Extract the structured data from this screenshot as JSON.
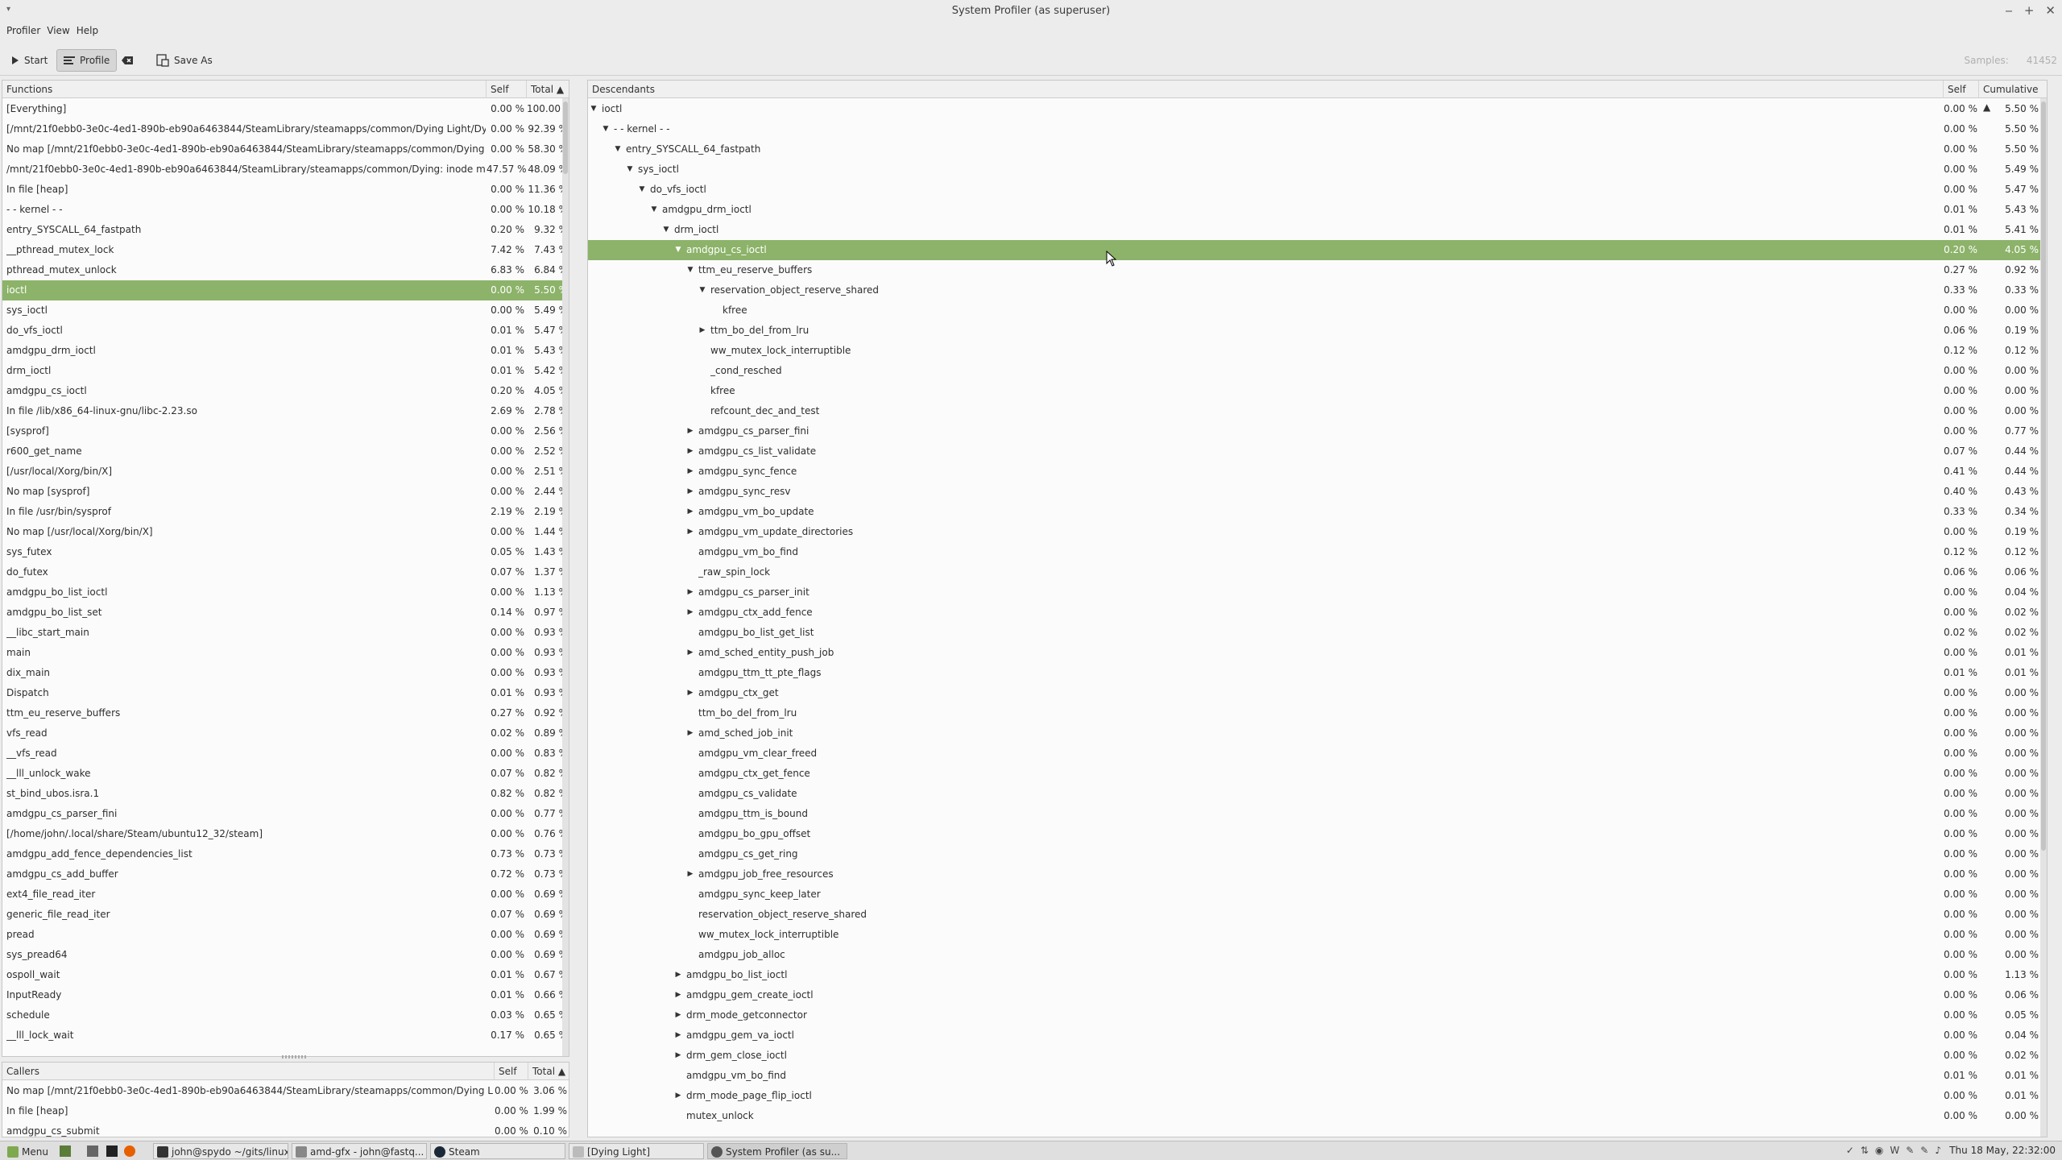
{
  "window": {
    "title": "System Profiler (as superuser)",
    "wm_menu": "▾",
    "wm_buttons": [
      "‒",
      "+",
      "✕"
    ]
  },
  "menubar": [
    "Profiler",
    "View",
    "Help"
  ],
  "toolbar": {
    "start_label": "Start",
    "profile_label": "Profile",
    "save_as_label": "Save As",
    "samples_label": "Samples:",
    "samples_value": "41452"
  },
  "functions": {
    "headers": {
      "name": "Functions",
      "self": "Self",
      "total": "Total ▲"
    },
    "selected_index": 10,
    "rows": [
      [
        "[Everything]",
        "0.00 %",
        "100.00 %"
      ],
      [
        "[/mnt/21f0ebb0-3e0c-4ed1-890b-eb90a6463844/SteamLibrary/steamapps/common/Dying Light/DyingLi...",
        "0.00 %",
        "92.39 %"
      ],
      [
        "No map [/mnt/21f0ebb0-3e0c-4ed1-890b-eb90a6463844/SteamLibrary/steamapps/common/Dying Light...",
        "0.00 %",
        "58.30 %"
      ],
      [
        "/mnt/21f0ebb0-3e0c-4ed1-890b-eb90a6463844/SteamLibrary/steamapps/common/Dying: inode misma...",
        "47.57 %",
        "48.09 %"
      ],
      [
        "In file [heap]",
        "0.00 %",
        "11.36 %"
      ],
      [
        "- - kernel - -",
        "0.00 %",
        "10.18 %"
      ],
      [
        "entry_SYSCALL_64_fastpath",
        "0.20 %",
        "9.32 %"
      ],
      [
        "__pthread_mutex_lock",
        "7.42 %",
        "7.43 %"
      ],
      [
        "pthread_mutex_unlock",
        "6.83 %",
        "6.84 %"
      ],
      [
        "",
        "",
        ""
      ],
      [
        "ioctl",
        "0.00 %",
        "5.50 %"
      ],
      [
        "sys_ioctl",
        "0.00 %",
        "5.49 %"
      ],
      [
        "do_vfs_ioctl",
        "0.01 %",
        "5.47 %"
      ],
      [
        "amdgpu_drm_ioctl",
        "0.01 %",
        "5.43 %"
      ],
      [
        "drm_ioctl",
        "0.01 %",
        "5.42 %"
      ],
      [
        "amdgpu_cs_ioctl",
        "0.20 %",
        "4.05 %"
      ],
      [
        "In file /lib/x86_64-linux-gnu/libc-2.23.so",
        "2.69 %",
        "2.78 %"
      ],
      [
        "[sysprof]",
        "0.00 %",
        "2.56 %"
      ],
      [
        "r600_get_name",
        "0.00 %",
        "2.52 %"
      ],
      [
        "[/usr/local/Xorg/bin/X]",
        "0.00 %",
        "2.51 %"
      ],
      [
        "No map [sysprof]",
        "0.00 %",
        "2.44 %"
      ],
      [
        "In file /usr/bin/sysprof",
        "2.19 %",
        "2.19 %"
      ],
      [
        "No map [/usr/local/Xorg/bin/X]",
        "0.00 %",
        "1.44 %"
      ],
      [
        "sys_futex",
        "0.05 %",
        "1.43 %"
      ],
      [
        "do_futex",
        "0.07 %",
        "1.37 %"
      ],
      [
        "amdgpu_bo_list_ioctl",
        "0.00 %",
        "1.13 %"
      ],
      [
        "amdgpu_bo_list_set",
        "0.14 %",
        "0.97 %"
      ],
      [
        "__libc_start_main",
        "0.00 %",
        "0.93 %"
      ],
      [
        "main",
        "0.00 %",
        "0.93 %"
      ],
      [
        "dix_main",
        "0.00 %",
        "0.93 %"
      ],
      [
        "Dispatch",
        "0.01 %",
        "0.93 %"
      ],
      [
        "ttm_eu_reserve_buffers",
        "0.27 %",
        "0.92 %"
      ],
      [
        "vfs_read",
        "0.02 %",
        "0.89 %"
      ],
      [
        "__vfs_read",
        "0.00 %",
        "0.83 %"
      ],
      [
        "__lll_unlock_wake",
        "0.07 %",
        "0.82 %"
      ],
      [
        "st_bind_ubos.isra.1",
        "0.82 %",
        "0.82 %"
      ],
      [
        "amdgpu_cs_parser_fini",
        "0.00 %",
        "0.77 %"
      ],
      [
        "[/home/john/.local/share/Steam/ubuntu12_32/steam]",
        "0.00 %",
        "0.76 %"
      ],
      [
        "amdgpu_add_fence_dependencies_list",
        "0.73 %",
        "0.73 %"
      ],
      [
        "amdgpu_cs_add_buffer",
        "0.72 %",
        "0.73 %"
      ],
      [
        "ext4_file_read_iter",
        "0.00 %",
        "0.69 %"
      ],
      [
        "generic_file_read_iter",
        "0.07 %",
        "0.69 %"
      ],
      [
        "pread",
        "0.00 %",
        "0.69 %"
      ],
      [
        "sys_pread64",
        "0.00 %",
        "0.69 %"
      ],
      [
        "ospoll_wait",
        "0.01 %",
        "0.67 %"
      ],
      [
        "InputReady",
        "0.01 %",
        "0.66 %"
      ],
      [
        "schedule",
        "0.03 %",
        "0.65 %"
      ],
      [
        "__lll_lock_wait",
        "0.17 %",
        "0.65 %"
      ]
    ]
  },
  "callers": {
    "headers": {
      "name": "Callers",
      "self": "Self",
      "total": "Total ▲"
    },
    "rows": [
      [
        "No map [/mnt/21f0ebb0-3e0c-4ed1-890b-eb90a6463844/SteamLibrary/steamapps/common/Dying Light/...",
        "0.00 %",
        "3.06 %"
      ],
      [
        "In file [heap]",
        "0.00 %",
        "1.99 %"
      ],
      [
        "amdgpu_cs_submit",
        "0.00 %",
        "0.10 %"
      ]
    ]
  },
  "descendants": {
    "headers": {
      "name": "Descendants",
      "self": "Self",
      "cumulative": "Cumulative ▲"
    },
    "selected_index": 7,
    "rows": [
      {
        "name": "ioctl",
        "depth": 0,
        "exp": "open",
        "self": "0.00 %",
        "cum": "5.50 %"
      },
      {
        "name": "- - kernel - -",
        "depth": 1,
        "exp": "open",
        "self": "0.00 %",
        "cum": "5.50 %"
      },
      {
        "name": "entry_SYSCALL_64_fastpath",
        "depth": 2,
        "exp": "open",
        "self": "0.00 %",
        "cum": "5.50 %"
      },
      {
        "name": "sys_ioctl",
        "depth": 3,
        "exp": "open",
        "self": "0.00 %",
        "cum": "5.49 %"
      },
      {
        "name": "do_vfs_ioctl",
        "depth": 4,
        "exp": "open",
        "self": "0.00 %",
        "cum": "5.47 %"
      },
      {
        "name": "amdgpu_drm_ioctl",
        "depth": 5,
        "exp": "open",
        "self": "0.01 %",
        "cum": "5.43 %"
      },
      {
        "name": "drm_ioctl",
        "depth": 6,
        "exp": "open",
        "self": "0.01 %",
        "cum": "5.41 %"
      },
      {
        "name": "amdgpu_cs_ioctl",
        "depth": 7,
        "exp": "open",
        "self": "0.20 %",
        "cum": "4.05 %"
      },
      {
        "name": "ttm_eu_reserve_buffers",
        "depth": 8,
        "exp": "open",
        "self": "0.27 %",
        "cum": "0.92 %"
      },
      {
        "name": "reservation_object_reserve_shared",
        "depth": 9,
        "exp": "open",
        "self": "0.33 %",
        "cum": "0.33 %"
      },
      {
        "name": "kfree",
        "depth": 10,
        "exp": "",
        "self": "0.00 %",
        "cum": "0.00 %"
      },
      {
        "name": "ttm_bo_del_from_lru",
        "depth": 9,
        "exp": "closed",
        "self": "0.06 %",
        "cum": "0.19 %"
      },
      {
        "name": "ww_mutex_lock_interruptible",
        "depth": 9,
        "exp": "",
        "self": "0.12 %",
        "cum": "0.12 %"
      },
      {
        "name": "_cond_resched",
        "depth": 9,
        "exp": "",
        "self": "0.00 %",
        "cum": "0.00 %"
      },
      {
        "name": "kfree",
        "depth": 9,
        "exp": "",
        "self": "0.00 %",
        "cum": "0.00 %"
      },
      {
        "name": "refcount_dec_and_test",
        "depth": 9,
        "exp": "",
        "self": "0.00 %",
        "cum": "0.00 %"
      },
      {
        "name": "amdgpu_cs_parser_fini",
        "depth": 8,
        "exp": "closed",
        "self": "0.00 %",
        "cum": "0.77 %"
      },
      {
        "name": "amdgpu_cs_list_validate",
        "depth": 8,
        "exp": "closed",
        "self": "0.07 %",
        "cum": "0.44 %"
      },
      {
        "name": "amdgpu_sync_fence",
        "depth": 8,
        "exp": "closed",
        "self": "0.41 %",
        "cum": "0.44 %"
      },
      {
        "name": "amdgpu_sync_resv",
        "depth": 8,
        "exp": "closed",
        "self": "0.40 %",
        "cum": "0.43 %"
      },
      {
        "name": "amdgpu_vm_bo_update",
        "depth": 8,
        "exp": "closed",
        "self": "0.33 %",
        "cum": "0.34 %"
      },
      {
        "name": "amdgpu_vm_update_directories",
        "depth": 8,
        "exp": "closed",
        "self": "0.00 %",
        "cum": "0.19 %"
      },
      {
        "name": "amdgpu_vm_bo_find",
        "depth": 8,
        "exp": "",
        "self": "0.12 %",
        "cum": "0.12 %"
      },
      {
        "name": "_raw_spin_lock",
        "depth": 8,
        "exp": "",
        "self": "0.06 %",
        "cum": "0.06 %"
      },
      {
        "name": "amdgpu_cs_parser_init",
        "depth": 8,
        "exp": "closed",
        "self": "0.00 %",
        "cum": "0.04 %"
      },
      {
        "name": "amdgpu_ctx_add_fence",
        "depth": 8,
        "exp": "closed",
        "self": "0.00 %",
        "cum": "0.02 %"
      },
      {
        "name": "amdgpu_bo_list_get_list",
        "depth": 8,
        "exp": "",
        "self": "0.02 %",
        "cum": "0.02 %"
      },
      {
        "name": "amd_sched_entity_push_job",
        "depth": 8,
        "exp": "closed",
        "self": "0.00 %",
        "cum": "0.01 %"
      },
      {
        "name": "amdgpu_ttm_tt_pte_flags",
        "depth": 8,
        "exp": "",
        "self": "0.01 %",
        "cum": "0.01 %"
      },
      {
        "name": "amdgpu_ctx_get",
        "depth": 8,
        "exp": "closed",
        "self": "0.00 %",
        "cum": "0.00 %"
      },
      {
        "name": "ttm_bo_del_from_lru",
        "depth": 8,
        "exp": "",
        "self": "0.00 %",
        "cum": "0.00 %"
      },
      {
        "name": "amd_sched_job_init",
        "depth": 8,
        "exp": "closed",
        "self": "0.00 %",
        "cum": "0.00 %"
      },
      {
        "name": "amdgpu_vm_clear_freed",
        "depth": 8,
        "exp": "",
        "self": "0.00 %",
        "cum": "0.00 %"
      },
      {
        "name": "amdgpu_ctx_get_fence",
        "depth": 8,
        "exp": "",
        "self": "0.00 %",
        "cum": "0.00 %"
      },
      {
        "name": "amdgpu_cs_validate",
        "depth": 8,
        "exp": "",
        "self": "0.00 %",
        "cum": "0.00 %"
      },
      {
        "name": "amdgpu_ttm_is_bound",
        "depth": 8,
        "exp": "",
        "self": "0.00 %",
        "cum": "0.00 %"
      },
      {
        "name": "amdgpu_bo_gpu_offset",
        "depth": 8,
        "exp": "",
        "self": "0.00 %",
        "cum": "0.00 %"
      },
      {
        "name": "amdgpu_cs_get_ring",
        "depth": 8,
        "exp": "",
        "self": "0.00 %",
        "cum": "0.00 %"
      },
      {
        "name": "amdgpu_job_free_resources",
        "depth": 8,
        "exp": "closed",
        "self": "0.00 %",
        "cum": "0.00 %"
      },
      {
        "name": "amdgpu_sync_keep_later",
        "depth": 8,
        "exp": "",
        "self": "0.00 %",
        "cum": "0.00 %"
      },
      {
        "name": "reservation_object_reserve_shared",
        "depth": 8,
        "exp": "",
        "self": "0.00 %",
        "cum": "0.00 %"
      },
      {
        "name": "ww_mutex_lock_interruptible",
        "depth": 8,
        "exp": "",
        "self": "0.00 %",
        "cum": "0.00 %"
      },
      {
        "name": "amdgpu_job_alloc",
        "depth": 8,
        "exp": "",
        "self": "0.00 %",
        "cum": "0.00 %"
      },
      {
        "name": "amdgpu_bo_list_ioctl",
        "depth": 7,
        "exp": "closed",
        "self": "0.00 %",
        "cum": "1.13 %"
      },
      {
        "name": "amdgpu_gem_create_ioctl",
        "depth": 7,
        "exp": "closed",
        "self": "0.00 %",
        "cum": "0.06 %"
      },
      {
        "name": "drm_mode_getconnector",
        "depth": 7,
        "exp": "closed",
        "self": "0.00 %",
        "cum": "0.05 %"
      },
      {
        "name": "amdgpu_gem_va_ioctl",
        "depth": 7,
        "exp": "closed",
        "self": "0.00 %",
        "cum": "0.04 %"
      },
      {
        "name": "drm_gem_close_ioctl",
        "depth": 7,
        "exp": "closed",
        "self": "0.00 %",
        "cum": "0.02 %"
      },
      {
        "name": "amdgpu_vm_bo_find",
        "depth": 7,
        "exp": "",
        "self": "0.01 %",
        "cum": "0.01 %"
      },
      {
        "name": "drm_mode_page_flip_ioctl",
        "depth": 7,
        "exp": "closed",
        "self": "0.00 %",
        "cum": "0.01 %"
      },
      {
        "name": "mutex_unlock",
        "depth": 7,
        "exp": "",
        "self": "0.00 %",
        "cum": "0.00 %"
      }
    ]
  },
  "taskbar": {
    "menu_label": "Menu",
    "items": [
      "john@spydo ~/gits/linux",
      "amd-gfx - john@fastq...",
      "Steam",
      "[Dying Light]",
      "System Profiler (as su..."
    ],
    "clock": "Thu 18 May, 22:32:00"
  },
  "colors": {
    "selection": "#8cb369",
    "panel_bg": "#fbfbfb"
  }
}
